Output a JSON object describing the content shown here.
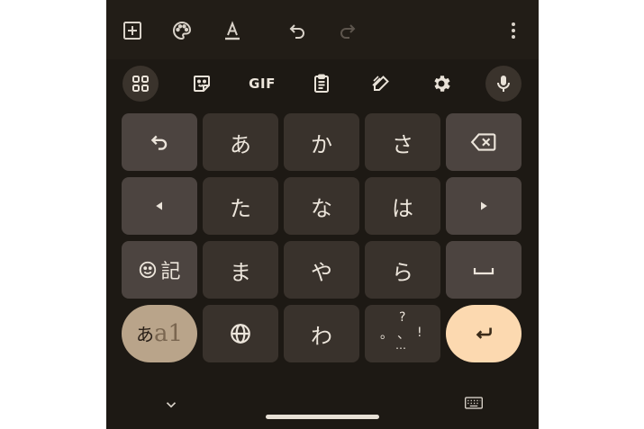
{
  "toolbar": {
    "icons": [
      "add-box-icon",
      "palette-icon",
      "text-format-icon",
      "undo-icon",
      "redo-icon",
      "more-vert-icon"
    ]
  },
  "suggestion_strip": {
    "icons": [
      "apps-grid-icon",
      "sticker-icon",
      "gif-icon",
      "clipboard-icon",
      "handwriting-icon",
      "settings-gear-icon",
      "microphone-icon"
    ],
    "gif_label": "GIF"
  },
  "keys": {
    "row1": [
      "あ",
      "か",
      "さ"
    ],
    "row2": [
      "た",
      "な",
      "は"
    ],
    "row3": [
      "ま",
      "や",
      "ら"
    ],
    "row4": [
      "わ"
    ],
    "emoji_kigo": "記",
    "mode_kana": "あ",
    "mode_alnum": "a1",
    "punct": {
      "top": "?",
      "left": "。",
      "mid": "、",
      "right": "!",
      "bottom": "…"
    }
  },
  "colors": {
    "background": "#1d1914",
    "key": "#39322c",
    "function_key": "#4c4440",
    "mode_key": "#b9a48a",
    "enter_key": "#fcd9b0"
  }
}
